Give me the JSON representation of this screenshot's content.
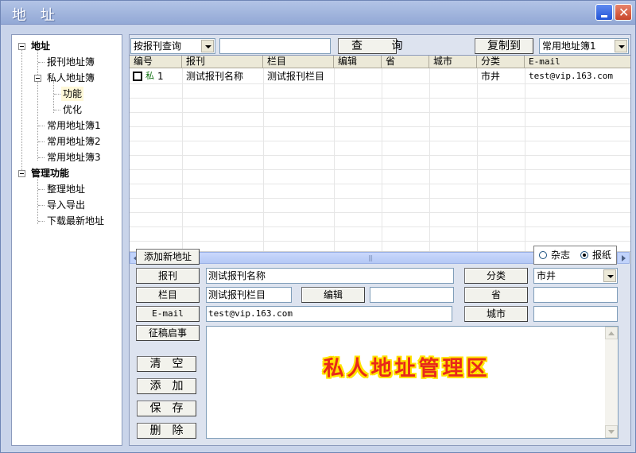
{
  "window": {
    "title": "地 址"
  },
  "tree": {
    "root1": "地址",
    "items_root1": [
      "报刊地址簿",
      "私人地址簿",
      "功能",
      "优化",
      "常用地址簿1",
      "常用地址簿2",
      "常用地址簿3"
    ],
    "root2": "管理功能",
    "items_root2": [
      "整理地址",
      "导入导出",
      "下载最新地址"
    ]
  },
  "toolbar": {
    "query_type": "按报刊查询",
    "search_value": "",
    "query_button": "查 询",
    "copy_button": "复制到",
    "target_book": "常用地址簿1"
  },
  "grid": {
    "columns": [
      "编号",
      "报刊",
      "栏目",
      "编辑",
      "省",
      "城市",
      "分类",
      "E-mail"
    ],
    "rows": [
      {
        "checked": false,
        "tag": "私",
        "id": "1",
        "journal": "测试报刊名称",
        "column": "测试报刊栏目",
        "editor": "",
        "province": "",
        "city": "",
        "category": "市井",
        "email": "test@vip.163.com"
      }
    ]
  },
  "form": {
    "add_new": "添加新地址",
    "type_options": [
      "杂志",
      "报纸"
    ],
    "type_selected": "报纸",
    "journal_label": "报刊",
    "journal_value": "测试报刊名称",
    "column_label": "栏目",
    "column_value": "测试报刊栏目",
    "editor_label": "编辑",
    "editor_value": "",
    "email_label": "E-mail",
    "email_value": "test@vip.163.com",
    "notice_label": "征稿启事",
    "category_label": "分类",
    "category_value": "市井",
    "province_label": "省",
    "province_value": "",
    "city_label": "城市",
    "city_value": "",
    "banner": "私人地址管理区",
    "clear_button": "清空",
    "add_button": "添加",
    "save_button": "保存",
    "delete_button": "删除"
  },
  "colors": {
    "banner_fill": "#e8291a",
    "banner_outline": "#ffe400"
  }
}
